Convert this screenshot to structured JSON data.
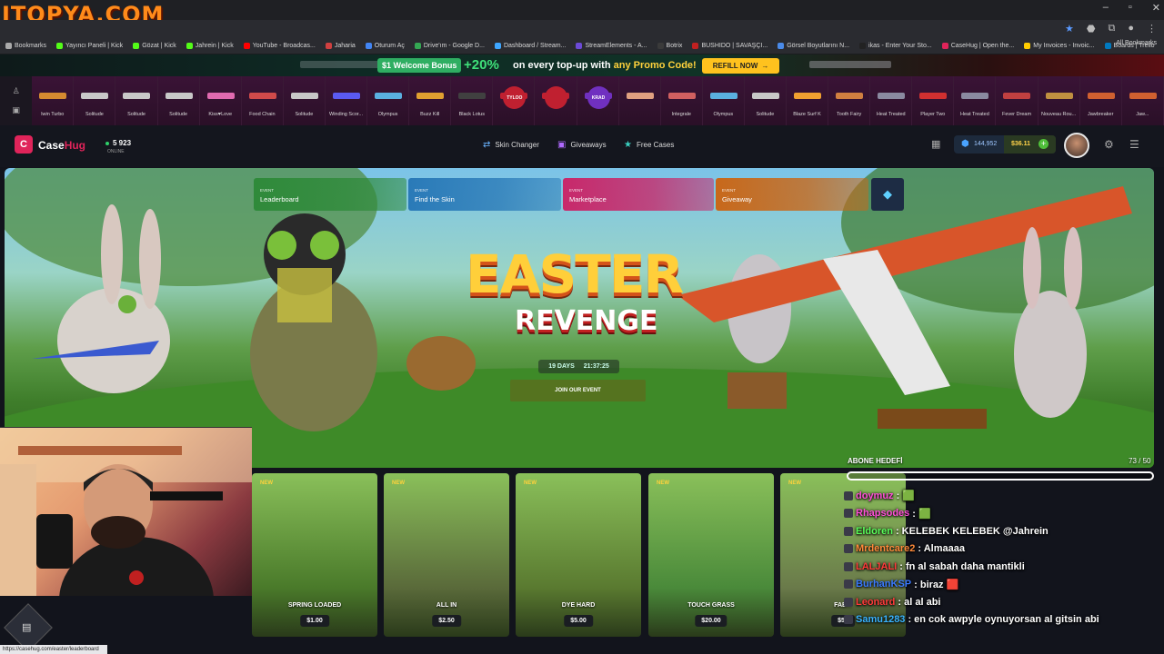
{
  "watermark": "ITOPYA.COM",
  "browser": {
    "url": "casehug.com",
    "bookmarks": [
      {
        "label": "Bookmarks",
        "color": "#aaaaaa"
      },
      {
        "label": "Yayıncı Paneli | Kick",
        "color": "#53fc18"
      },
      {
        "label": "Gözat | Kick",
        "color": "#53fc18"
      },
      {
        "label": "Jahrein | Kick",
        "color": "#53fc18"
      },
      {
        "label": "YouTube - Broadcas...",
        "color": "#ff0000"
      },
      {
        "label": "Jaharia",
        "color": "#d04040"
      },
      {
        "label": "Oturum Aç",
        "color": "#4285f4"
      },
      {
        "label": "Drive'ım - Google D...",
        "color": "#34a853"
      },
      {
        "label": "Dashboard / Stream...",
        "color": "#3ea6ff"
      },
      {
        "label": "StreamElements - A...",
        "color": "#6c4ad6"
      },
      {
        "label": "Botrix",
        "color": "#3a3a3a"
      },
      {
        "label": "BUSHIDO | SAVAŞÇI...",
        "color": "#c02020"
      },
      {
        "label": "Görsel Boyutlarını N...",
        "color": "#4a8ae8"
      },
      {
        "label": "ikas - Enter Your Sto...",
        "color": "#222222"
      },
      {
        "label": "CaseHug | Open the...",
        "color": "#e0245a"
      },
      {
        "label": "My Invoices - Invoic...",
        "color": "#ffcc00"
      },
      {
        "label": "Boards | Trello",
        "color": "#0079bf"
      }
    ],
    "all_bookmarks": "All Bookmarks",
    "status_url": "https://casehug.com/easter/leaderboard"
  },
  "promo": {
    "badge": "$1 Welcome Bonus",
    "percent": "+20%",
    "text_prefix": "on every top-up with",
    "text_highlight": "any Promo Code!",
    "refill": "REFILL NOW"
  },
  "drops": [
    {
      "label": "lwin Turbo",
      "color": "#d48a30"
    },
    {
      "label": "Solitude",
      "color": "#c8c8c8"
    },
    {
      "label": "Solitude",
      "color": "#c8c8c8"
    },
    {
      "label": "Solitude",
      "color": "#c8c8c8"
    },
    {
      "label": "Kiss♥Love",
      "color": "#e06ab0"
    },
    {
      "label": "Food Chain",
      "color": "#d04a4a"
    },
    {
      "label": "Solitude",
      "color": "#c8c8c8"
    },
    {
      "label": "Winding Scor...",
      "color": "#5a5af0"
    },
    {
      "label": "Olympus",
      "color": "#5ab0e0"
    },
    {
      "label": "Buzz Kill",
      "color": "#e0a030"
    },
    {
      "label": "Black Lotus",
      "color": "#404040"
    },
    {
      "label": "",
      "color": "#c02030"
    },
    {
      "label": "",
      "color": "#c02030"
    },
    {
      "label": "",
      "color": "#7030c0"
    },
    {
      "label": "",
      "color": "#e0a080"
    },
    {
      "label": "Integrale",
      "color": "#d06060"
    },
    {
      "label": "Olympus",
      "color": "#5ab0e0"
    },
    {
      "label": "Solitude",
      "color": "#c8c8c8"
    },
    {
      "label": "Blaze Surf K",
      "color": "#f0a030"
    },
    {
      "label": "Tooth Fairy",
      "color": "#d08040"
    },
    {
      "label": "Heat Treated",
      "color": "#8a8aa0"
    },
    {
      "label": "Player Two",
      "color": "#d03030"
    },
    {
      "label": "Heat Treated",
      "color": "#8a8aa0"
    },
    {
      "label": "Fever Dream",
      "color": "#c04040"
    },
    {
      "label": "Nouveau Rou...",
      "color": "#c09040"
    },
    {
      "label": "Jawbreaker",
      "color": "#d06030"
    },
    {
      "label": "Jaw...",
      "color": "#d06030"
    }
  ],
  "drop_badges": [
    "TYLOO",
    "",
    "KRAD"
  ],
  "nav": {
    "brand_a": "Case",
    "brand_b": "Hug",
    "online_count": "5 923",
    "online_label": "ONLINE",
    "links": [
      {
        "label": "Skin Changer",
        "icon": "⇄"
      },
      {
        "label": "Giveaways",
        "icon": "▣"
      },
      {
        "label": "Free Cases",
        "icon": "★"
      }
    ],
    "coins": "144,952",
    "cash": "$36.11",
    "avatar_level": "79"
  },
  "events": [
    {
      "tag": "EVENT",
      "name": "Leaderboard",
      "color": "#2f8a3a"
    },
    {
      "tag": "EVENT",
      "name": "Find the Skin",
      "color": "#2a7ab8"
    },
    {
      "tag": "EVENT",
      "name": "Marketplace",
      "color": "#c8286a"
    },
    {
      "tag": "EVENT",
      "name": "Giveaway",
      "color": "#c8681a"
    }
  ],
  "hero": {
    "title_1": "EASTER",
    "title_2": "REVENGE",
    "days": "19 DAYS",
    "time": "21:37:25",
    "cta": "JOIN OUR EVENT"
  },
  "cards": [
    {
      "badge": "NEW",
      "name": "SPRING LOADED",
      "price": "$1.00",
      "bg": "#4a7a2a"
    },
    {
      "badge": "NEW",
      "name": "ALL IN",
      "price": "$2.50",
      "bg": "#5a6a3a"
    },
    {
      "badge": "NEW",
      "name": "DYE HARD",
      "price": "$5.00",
      "bg": "#5a7a30"
    },
    {
      "badge": "NEW",
      "name": "TOUCH GRASS",
      "price": "$20.00",
      "bg": "#4a8a3a"
    },
    {
      "badge": "NEW",
      "name": "FAB...",
      "price": "$50",
      "bg": "#6a7a4a"
    }
  ],
  "goal": {
    "label": "ABONE HEDEFİ",
    "count": "73 / 50"
  },
  "chat": [
    {
      "user": "doymuz",
      "text": ": 🟩",
      "color": "#ff4fd8"
    },
    {
      "user": "Rhapsodes",
      "text": ": 🟩",
      "color": "#ff4fd8"
    },
    {
      "user": "Eldoren",
      "text": ": KELEBEK KELEBEK @Jahrein",
      "color": "#5aff5a"
    },
    {
      "user": "Mrdentcare2",
      "text": ": Almaaaa",
      "color": "#ff8a3a"
    },
    {
      "user": "LALJALI",
      "text": ": fn al sabah daha mantikli",
      "color": "#ff3a3a"
    },
    {
      "user": "BurhanKSP",
      "text": ": biraz 🟥",
      "color": "#3a7aff"
    },
    {
      "user": "Leonard",
      "text": ": al al abi",
      "color": "#ff3a3a"
    },
    {
      "user": "Samu1283",
      "text": ": en cok awpyle oynuyorsan al gitsin abi",
      "color": "#3ab4ff"
    }
  ]
}
